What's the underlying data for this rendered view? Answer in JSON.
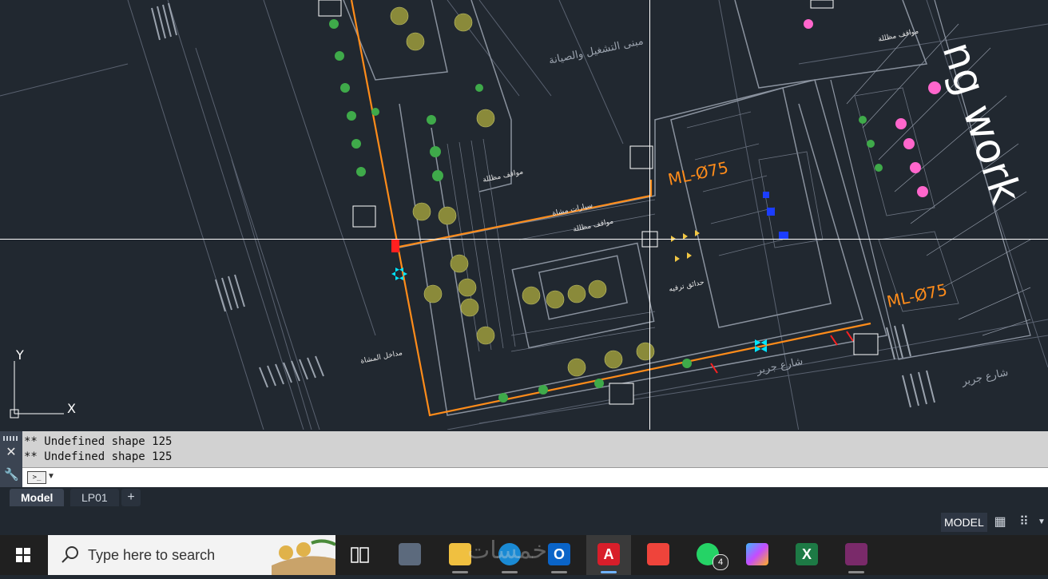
{
  "drawing": {
    "labels": {
      "title_fragment": "ng work",
      "ml_upper": "ML-Ø75",
      "ml_lower": "ML-Ø75",
      "street_jarir": "شارع جرير",
      "street_jarir_2": "شارع جرير",
      "street_maintenance": "مبنى التشغيل والصيانة",
      "parking_left": "مواقف مظللة",
      "parking_center": "مواقف مظللة",
      "parking_right": "مواقف مظللة",
      "cars_label": "سيارات مشاة",
      "entrance": "مداخل المشاة",
      "gardens": "حدائق ترفيه"
    },
    "crosshair": {
      "visible": true
    },
    "ucs": {
      "x_label": "X",
      "y_label": "Y"
    }
  },
  "command_line": {
    "history": [
      "** Undefined shape 125",
      "** Undefined shape 125"
    ],
    "input_value": "",
    "close_icon": "close-icon",
    "customize_icon": "wrench-icon"
  },
  "layout_tabs": {
    "tabs": [
      {
        "label": "Model",
        "active": true
      },
      {
        "label": "LP01",
        "active": false
      }
    ],
    "add_label": "+"
  },
  "status_bar": {
    "space_label": "MODEL",
    "icons": [
      "grid-icon",
      "snap-icon",
      "menu-arrow-icon"
    ]
  },
  "taskbar": {
    "search_placeholder": "Type here to search",
    "apps": [
      {
        "name": "task-view",
        "glyph": ""
      },
      {
        "name": "calculator",
        "glyph": ""
      },
      {
        "name": "file-explorer",
        "glyph": ""
      },
      {
        "name": "edge",
        "glyph": ""
      },
      {
        "name": "outlook",
        "glyph": "O"
      },
      {
        "name": "autocad",
        "glyph": "A"
      },
      {
        "name": "anydesk",
        "glyph": ""
      },
      {
        "name": "whatsapp",
        "glyph": "",
        "badge": "4"
      },
      {
        "name": "copilot",
        "glyph": ""
      },
      {
        "name": "excel",
        "glyph": "X"
      },
      {
        "name": "winrar",
        "glyph": ""
      }
    ],
    "watermark": "خمسات"
  },
  "colors": {
    "canvas_bg": "#212830",
    "orange_line": "#ff8c1a",
    "tree_fill": "#8a8a3a",
    "cyan": "#00e5ff",
    "pink": "#ff66cc",
    "red": "#ff2020"
  }
}
